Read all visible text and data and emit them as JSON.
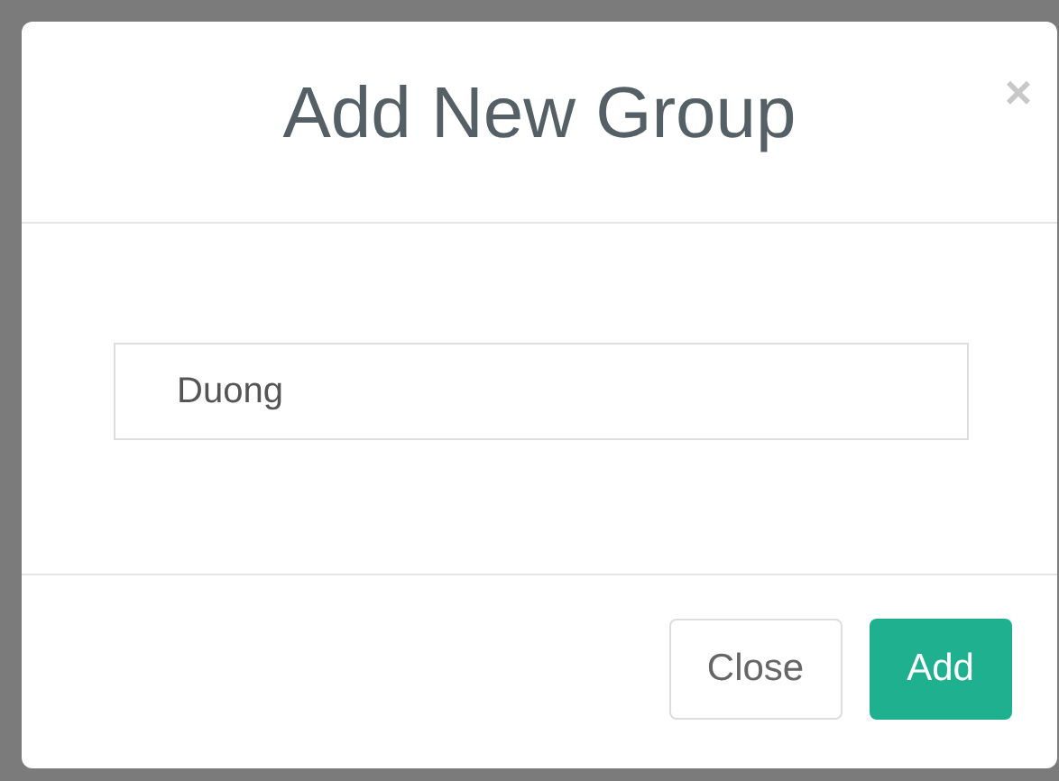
{
  "dialog": {
    "title": "Add New Group",
    "close_icon": "×",
    "field": {
      "value": "Duong"
    },
    "buttons": [
      {
        "label": "Close",
        "kind": "default"
      },
      {
        "label": "Add",
        "kind": "primary"
      }
    ]
  }
}
